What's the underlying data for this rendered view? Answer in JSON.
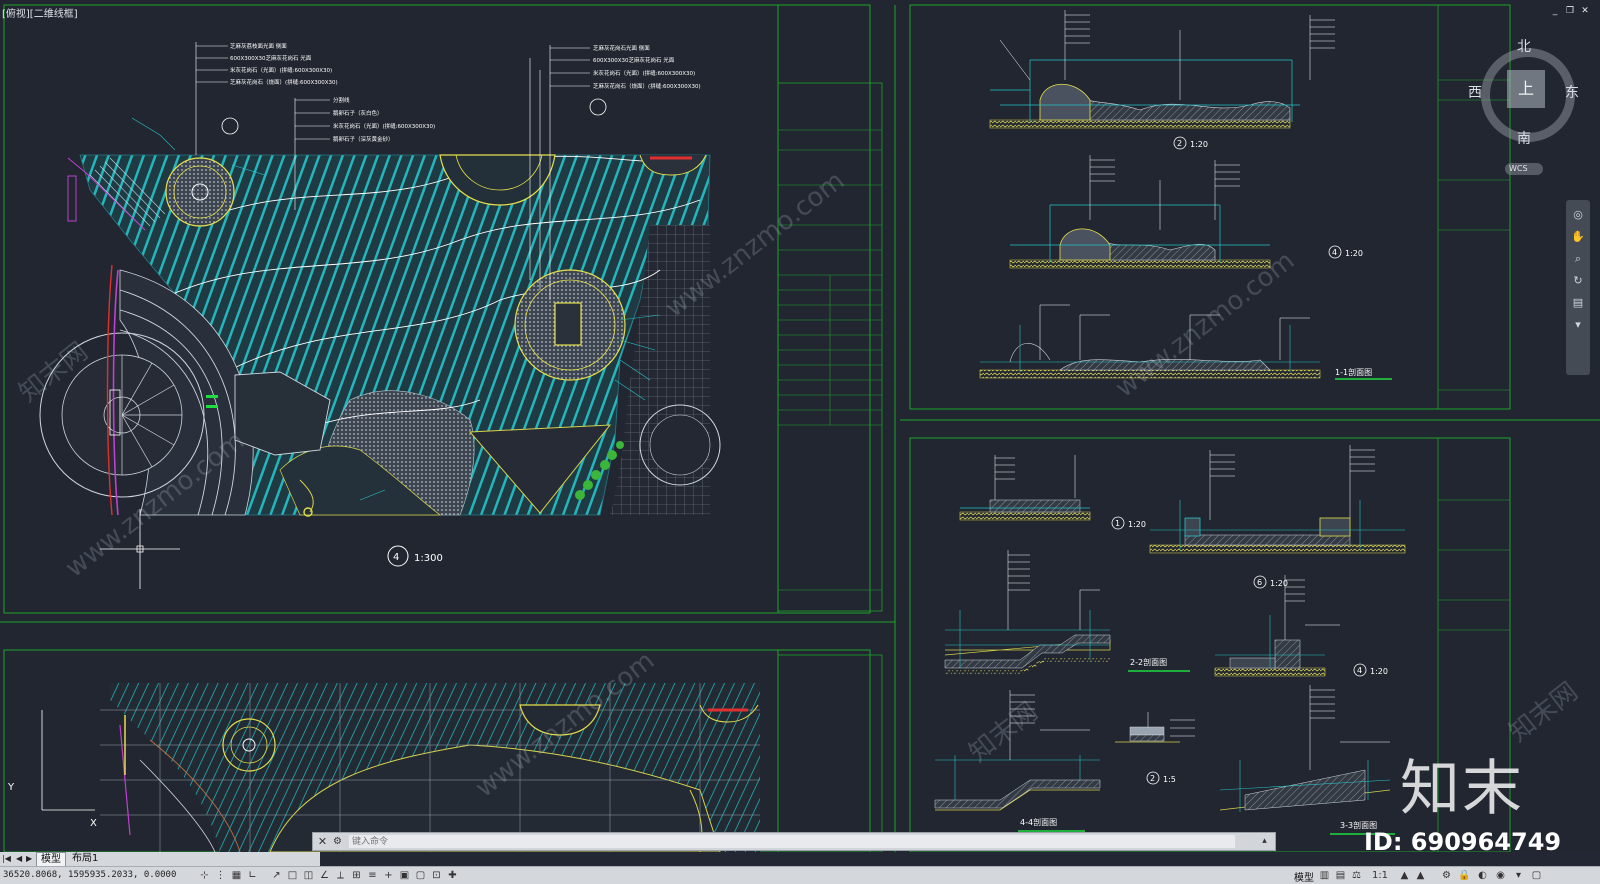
{
  "view_label": "[俯视][二维线框]",
  "window_controls": {
    "minimize": "_",
    "restore": "❐",
    "close": "✕"
  },
  "viewcube": {
    "north": "北",
    "south": "南",
    "west": "西",
    "east": "东",
    "top": "上",
    "wcs": "WCS"
  },
  "plan": {
    "scale_number": "4",
    "scale_label": "1:300",
    "labels_left": [
      "芝麻灰荔枝面光面 侧面",
      "600X300X30芝麻灰花岗石 光面",
      "米灰花岗石（光面）(拼缝:600X300X30)",
      "芝麻灰花岗石（烧面）(拼缝:600X300X30)",
      "分割线",
      "鹅卵石子（灰白色）",
      "米灰花岗石（光面）(拼缝:600X300X30)",
      "鹅卵石子（深灰黄金砂）"
    ],
    "labels_right": [
      "芝麻灰花岗石光面 侧面",
      "600X300X30芝麻灰花岗石 光面",
      "米灰花岗石（光面）(拼缝:600X300X30)",
      "芝麻灰花岗石（烧面）(拼缝:600X300X30)"
    ]
  },
  "sections_top": [
    {
      "number": "2",
      "scale": "1:20"
    },
    {
      "number": "4",
      "scale": "1:20"
    },
    {
      "number": "",
      "scale": "1-1剖面图"
    }
  ],
  "sections_bottom": [
    {
      "number": "1",
      "scale": "1:20"
    },
    {
      "number": "6",
      "scale": "1:20"
    },
    {
      "number": "",
      "scale": "2-2剖面图"
    },
    {
      "number": "4",
      "scale": "1:20"
    },
    {
      "number": "2",
      "scale": "1:5"
    },
    {
      "number": "",
      "scale": "4-4剖面图"
    },
    {
      "number": "",
      "scale": "3-3剖面图"
    }
  ],
  "ucs": {
    "y": "Y",
    "x": "X"
  },
  "command_line": {
    "placeholder": "键入命令"
  },
  "layout_tabs": {
    "model": "模型",
    "layout1": "布局1"
  },
  "status": {
    "coords": "36520.8068, 1595935.2033, 0.0000",
    "model_label": "模型",
    "annotation_scale": "1:1"
  },
  "watermark": {
    "logo": "知末",
    "id": "ID: 690964749",
    "site": "www.znzmo.com",
    "brand": "知末网"
  },
  "colors": {
    "background": "#212631",
    "frame_green": "#1fa32a",
    "hatch_cyan": "#27c4c8",
    "yellow": "#e0e040",
    "red": "#e03030"
  }
}
